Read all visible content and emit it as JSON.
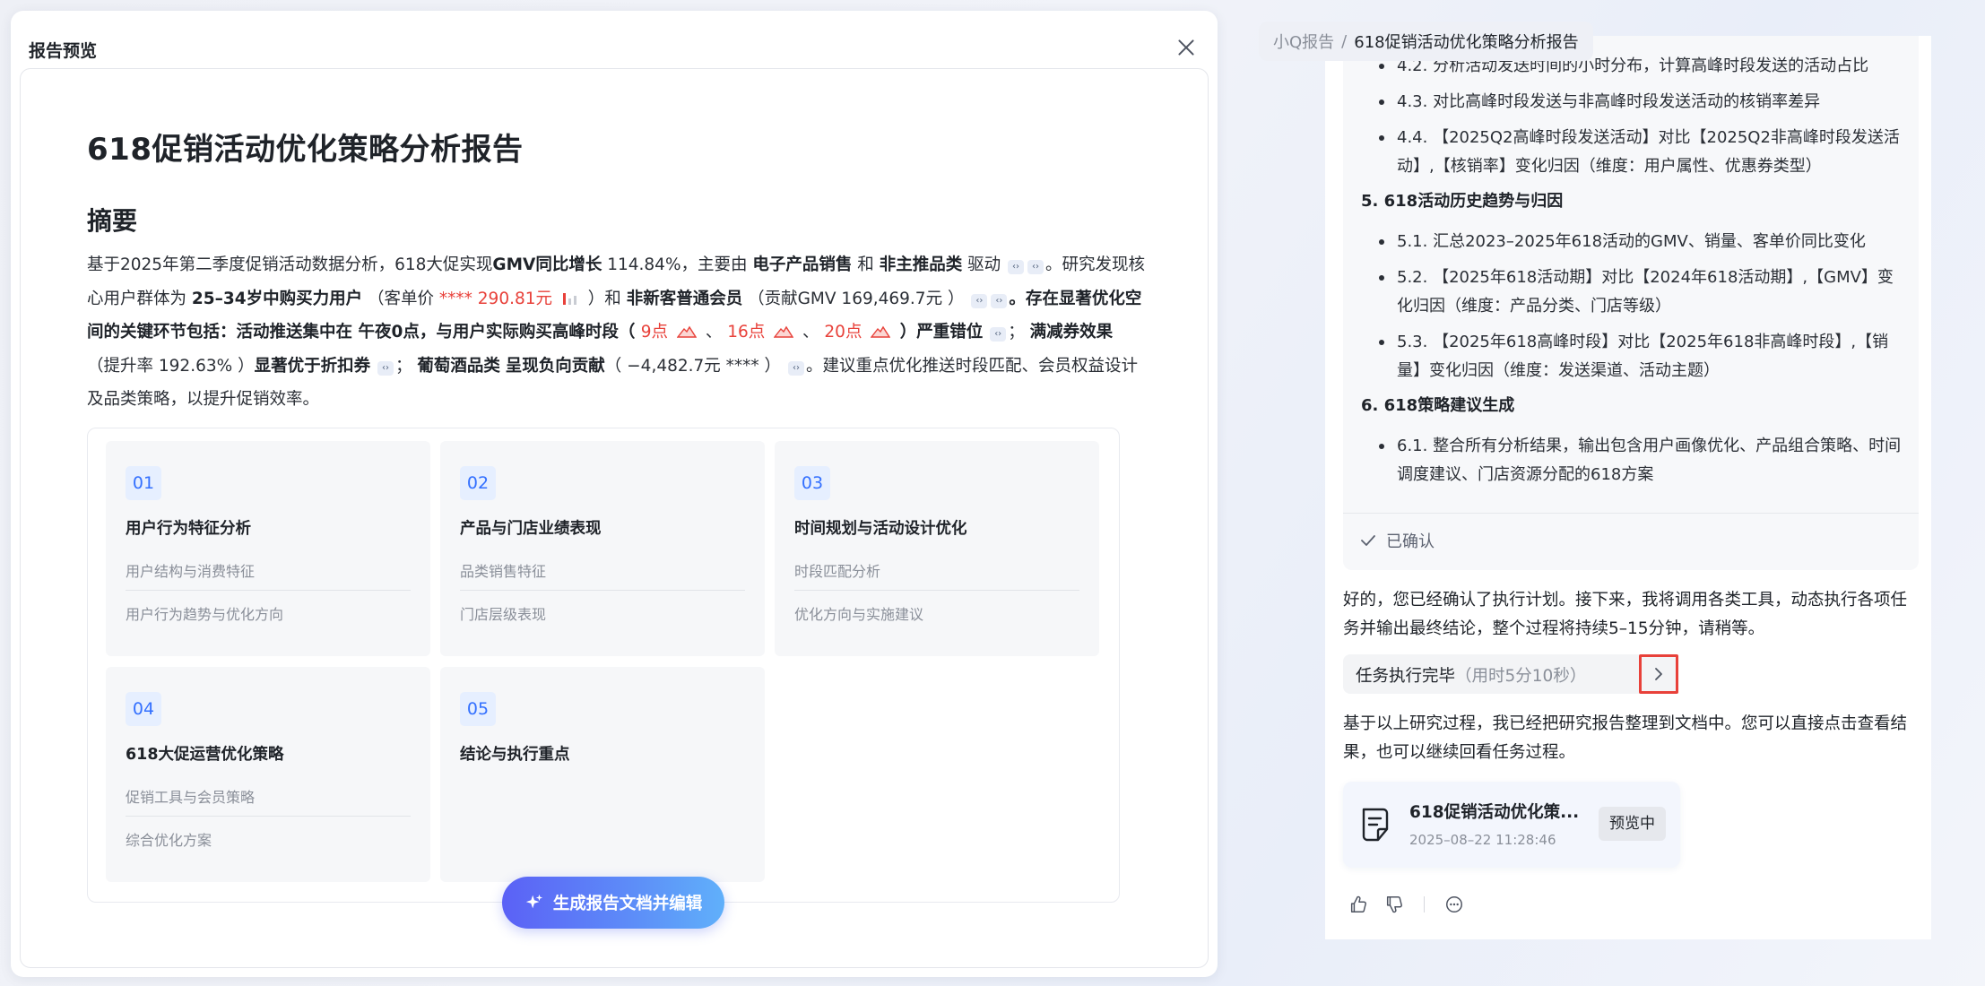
{
  "modal": {
    "title": "报告预览"
  },
  "report": {
    "title": "618促销活动优化策略分析报告",
    "summary_heading": "摘要",
    "summary": {
      "t1": "基于2025年第二季度促销活动数据分析，618大促实现",
      "b1": "GMV同比增长",
      "t2": " 114.84%，主要由 ",
      "b2": "电子产品销售",
      "t3": " 和 ",
      "b3": "非主推品类",
      "t4": " 驱动",
      "t5": "。研究发现核心用户群体为 ",
      "b4": "25–34岁中购买力用户",
      "t6": " （客单价 ",
      "r1": "**** 290.81元",
      "t7": " ）和 ",
      "b5": "非新客普通会员",
      "t8": " （贡献GMV 169,469.7元 ）",
      "b6": "。存在显著优化空间的关键环节包括：活动推送集中在 午夜0点，与用户实际购买高峰时段（ ",
      "r2": "9点",
      "t9": " 、 ",
      "r3": "16点",
      "t10": " 、 ",
      "r4": "20点",
      "b7": " ）严重错位",
      "t11": "； ",
      "b8": "满减券效果",
      "t12": "（提升率 192.63% ）",
      "b9": "显著优于折扣券",
      "t13": "； ",
      "b10": "葡萄酒品类",
      "t14": " ",
      "b11": "呈现负向贡献",
      "t15": "（ −4,482.7元 **** ）",
      "t16": "。建议重点优化推送时段匹配、会员权益设计及品类策略，以提升促销效率。"
    },
    "outline": [
      {
        "num": "01",
        "title": "用户行为特征分析",
        "subs": [
          "用户结构与消费特征",
          "用户行为趋势与优化方向"
        ]
      },
      {
        "num": "02",
        "title": "产品与门店业绩表现",
        "subs": [
          "品类销售特征",
          "门店层级表现"
        ]
      },
      {
        "num": "03",
        "title": "时间规划与活动设计优化",
        "subs": [
          "时段匹配分析",
          "优化方向与实施建议"
        ]
      },
      {
        "num": "04",
        "title": "618大促运营优化策略",
        "subs": [
          "促销工具与会员策略",
          "综合优化方案"
        ]
      },
      {
        "num": "05",
        "title": "结论与执行重点",
        "subs": []
      }
    ],
    "generate_button": "生成报告文档并编辑"
  },
  "chat": {
    "breadcrumb": {
      "root": "小Q报告",
      "separator": "/",
      "current": "618促销活动优化策略分析报告"
    },
    "plan": {
      "items_4": [
        "4.2. 分析活动发送时间的小时分布，计算高峰时段发送的活动占比",
        "4.3. 对比高峰时段发送与非高峰时段发送活动的核销率差异",
        "4.4. 【2025Q2高峰时段发送活动】对比【2025Q2非高峰时段发送活动】,【核销率】变化归因（维度：用户属性、优惠券类型）"
      ],
      "section_5": "5. 618活动历史趋势与归因",
      "items_5": [
        "5.1. 汇总2023–2025年618活动的GMV、销量、客单价同比变化",
        "5.2. 【2025年618活动期】对比【2024年618活动期】,【GMV】变化归因（维度：产品分类、门店等级）",
        "5.3. 【2025年618高峰时段】对比【2025年618非高峰时段】,【销量】变化归因（维度：发送渠道、活动主题）"
      ],
      "section_6": "6. 618策略建议生成",
      "items_6": [
        "6.1. 整合所有分析结果，输出包含用户画像优化、产品组合策略、时间调度建议、门店资源分配的618方案"
      ],
      "confirmed": "已确认"
    },
    "message_1": "好的，您已经确认了执行计划。接下来，我将调用各类工具，动态执行各项任务并输出最终结论，整个过程将持续5–15分钟，请稍等。",
    "task": {
      "label": "任务执行完毕",
      "duration": "（用时5分10秒）"
    },
    "message_2": "基于以上研究过程，我已经把研究报告整理到文档中。您可以直接点击查看结果，也可以继续回看任务过程。",
    "doc_card": {
      "name": "618促销活动优化策...",
      "time": "2025–08–22 11:28:46",
      "status": "预览中"
    }
  },
  "colors": {
    "accent": "#3370ff",
    "highlight": "#e8413a",
    "button_start": "#5b61f6",
    "button_end": "#60b0fa"
  }
}
